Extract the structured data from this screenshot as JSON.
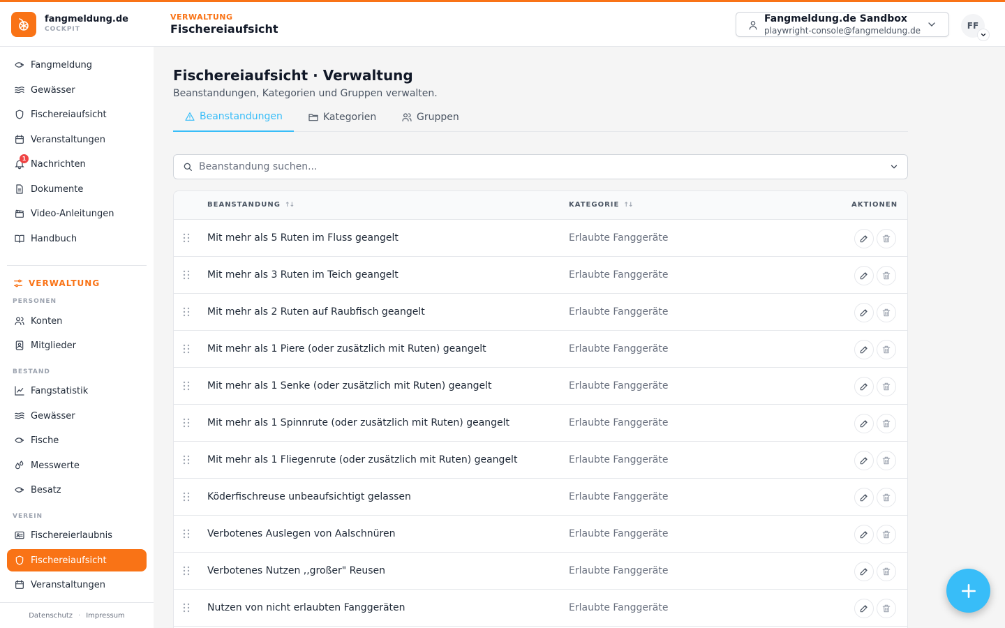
{
  "colors": {
    "accent": "#f97316",
    "primary": "#38bdf8",
    "badge": "#ef4444"
  },
  "app": {
    "name": "fangmeldung.de",
    "subtitle": "COCKPIT",
    "logo_icon": "fish-logo-icon"
  },
  "header": {
    "crumb_small": "VERWALTUNG",
    "crumb_title": "Fischereiaufsicht",
    "org": {
      "name": "Fangmeldung.de Sandbox",
      "email": "playwright-console@fangmeldung.de"
    },
    "avatar_initials": "FF"
  },
  "sidebar": {
    "main_items": [
      {
        "label": "Fangmeldung",
        "icon": "fish-icon"
      },
      {
        "label": "Gewässer",
        "icon": "waves-icon"
      },
      {
        "label": "Fischereiaufsicht",
        "icon": "shield-icon"
      },
      {
        "label": "Veranstaltungen",
        "icon": "calendar-icon"
      },
      {
        "label": "Nachrichten",
        "icon": "bell-icon",
        "badge": "1"
      },
      {
        "label": "Dokumente",
        "icon": "document-icon"
      },
      {
        "label": "Video-Anleitungen",
        "icon": "clapperboard-icon"
      },
      {
        "label": "Handbuch",
        "icon": "book-icon"
      }
    ],
    "admin_section": "VERWALTUNG",
    "groups": {
      "personen": {
        "heading": "PERSONEN",
        "items": [
          {
            "label": "Konten",
            "icon": "users-icon"
          },
          {
            "label": "Mitglieder",
            "icon": "id-badge-icon"
          }
        ]
      },
      "bestand": {
        "heading": "BESTAND",
        "items": [
          {
            "label": "Fangstatistik",
            "icon": "chart-line-icon"
          },
          {
            "label": "Gewässer",
            "icon": "waves-icon"
          },
          {
            "label": "Fische",
            "icon": "fish-icon"
          },
          {
            "label": "Messwerte",
            "icon": "droplets-icon"
          },
          {
            "label": "Besatz",
            "icon": "fish-icon"
          }
        ]
      },
      "verein": {
        "heading": "VEREIN",
        "items": [
          {
            "label": "Fischereierlaubnis",
            "icon": "id-card-icon"
          },
          {
            "label": "Fischereiaufsicht",
            "icon": "shield-icon",
            "active": true
          },
          {
            "label": "Veranstaltungen",
            "icon": "calendar-icon"
          }
        ]
      }
    },
    "footer": {
      "privacy": "Datenschutz",
      "separator": "·",
      "imprint": "Impressum"
    }
  },
  "main": {
    "title": "Fischereiaufsicht · Verwaltung",
    "subtitle": "Beanstandungen, Kategorien und Gruppen verwalten.",
    "tabs": [
      {
        "label": "Beanstandungen",
        "icon": "warning-triangle-icon",
        "active": true
      },
      {
        "label": "Kategorien",
        "icon": "folder-icon"
      },
      {
        "label": "Gruppen",
        "icon": "users-icon"
      }
    ],
    "search": {
      "placeholder": "Beanstandung suchen...",
      "value": ""
    },
    "table": {
      "columns": {
        "name": "BEANSTANDUNG",
        "category": "KATEGORIE",
        "actions": "AKTIONEN"
      },
      "sort_glyph": "↑↓",
      "rows": [
        {
          "name": "Mit mehr als 5 Ruten im Fluss geangelt",
          "category": "Erlaubte Fanggeräte"
        },
        {
          "name": "Mit mehr als 3 Ruten im Teich geangelt",
          "category": "Erlaubte Fanggeräte"
        },
        {
          "name": "Mit mehr als 2 Ruten auf Raubfisch geangelt",
          "category": "Erlaubte Fanggeräte"
        },
        {
          "name": "Mit mehr als 1 Piere (oder zusätzlich mit Ruten) geangelt",
          "category": "Erlaubte Fanggeräte"
        },
        {
          "name": "Mit mehr als 1 Senke (oder zusätzlich mit Ruten) geangelt",
          "category": "Erlaubte Fanggeräte"
        },
        {
          "name": "Mit mehr als 1 Spinnrute (oder zusätzlich mit Ruten) geangelt",
          "category": "Erlaubte Fanggeräte"
        },
        {
          "name": "Mit mehr als 1 Fliegenrute (oder zusätzlich mit Ruten) geangelt",
          "category": "Erlaubte Fanggeräte"
        },
        {
          "name": "Köderfischreuse unbeaufsichtigt gelassen",
          "category": "Erlaubte Fanggeräte"
        },
        {
          "name": "Verbotenes Auslegen von Aalschnüren",
          "category": "Erlaubte Fanggeräte"
        },
        {
          "name": "Verbotenes Nutzen ,,großer\" Reusen",
          "category": "Erlaubte Fanggeräte"
        },
        {
          "name": "Nutzen von nicht erlaubten Fanggeräten",
          "category": "Erlaubte Fanggeräte"
        }
      ]
    }
  }
}
